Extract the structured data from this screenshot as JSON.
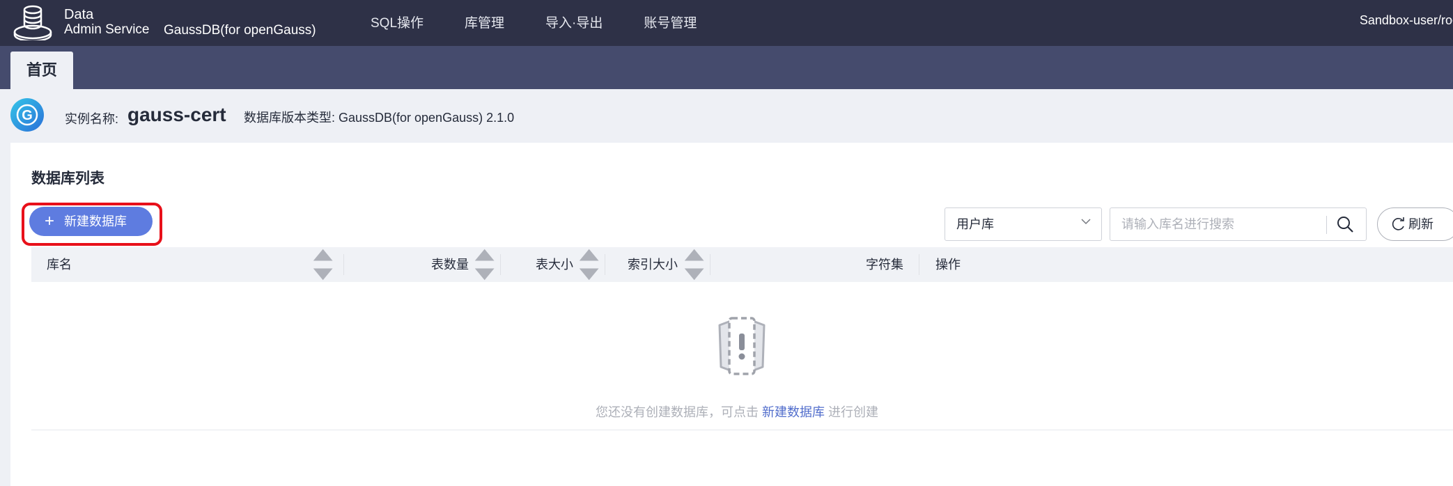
{
  "header": {
    "brand_line1": "Data",
    "brand_line2": "Admin Service",
    "product": "GaussDB(for openGauss)",
    "nav": [
      "SQL操作",
      "库管理",
      "导入·导出",
      "账号管理"
    ],
    "user": "Sandbox-user/root"
  },
  "tabs": {
    "home": "首页"
  },
  "instance": {
    "name_label": "实例名称:",
    "name": "gauss-cert",
    "version": "数据库版本类型: GaussDB(for openGauss) 2.1.0"
  },
  "db_list": {
    "title": "数据库列表",
    "create_button": "新建数据库",
    "filter_selected": "用户库",
    "search_placeholder": "请输入库名进行搜索",
    "refresh_label": "刷新",
    "columns": {
      "name": "库名",
      "table_count": "表数量",
      "table_size": "表大小",
      "index_size": "索引大小",
      "charset": "字符集",
      "actions": "操作"
    },
    "empty": {
      "prefix": "您还没有创建数据库，可点击 ",
      "link": "新建数据库",
      "suffix": " 进行创建"
    }
  },
  "colors": {
    "topbar": "#2e3147",
    "tabbar": "#454b6d",
    "primary": "#5e7ce0",
    "highlight_border": "#e8101a",
    "link": "#526ecc"
  }
}
